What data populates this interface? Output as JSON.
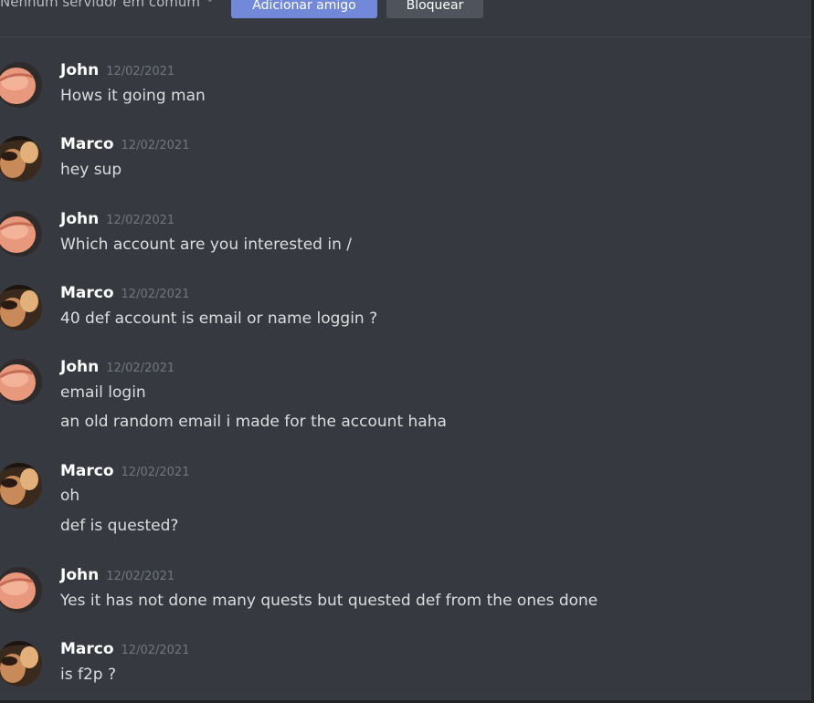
{
  "header": {
    "mutual_servers": "Nenhum servidor em comum",
    "separator": "•",
    "add_friend_label": "Adicionar amigo",
    "block_label": "Bloquear"
  },
  "messages": [
    {
      "author": "John",
      "timestamp": "12/02/2021",
      "lines": [
        "Hows it going man"
      ]
    },
    {
      "author": "Marco",
      "timestamp": "12/02/2021",
      "lines": [
        "hey sup"
      ]
    },
    {
      "author": "John",
      "timestamp": "12/02/2021",
      "lines": [
        "Which account are you interested in /"
      ]
    },
    {
      "author": "Marco",
      "timestamp": "12/02/2021",
      "lines": [
        "40 def account is email or name loggin ?"
      ]
    },
    {
      "author": "John",
      "timestamp": "12/02/2021",
      "lines": [
        "email login",
        "an old random email i made for the account haha"
      ]
    },
    {
      "author": "Marco",
      "timestamp": "12/02/2021",
      "lines": [
        "oh",
        "def is quested?"
      ]
    },
    {
      "author": "John",
      "timestamp": "12/02/2021",
      "lines": [
        "Yes it has not done many quests but quested def from the ones done"
      ]
    },
    {
      "author": "Marco",
      "timestamp": "12/02/2021",
      "lines": [
        "is f2p ?"
      ]
    }
  ],
  "colors": {
    "background": "#36393f",
    "author": "#ffffff",
    "timestamp": "#72767d",
    "text": "#dcddde",
    "add_button": "#7289da",
    "block_button": "#4f545c"
  }
}
